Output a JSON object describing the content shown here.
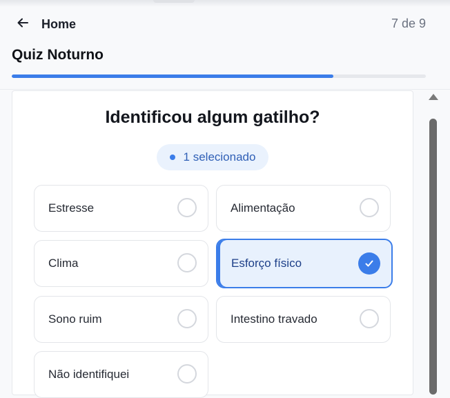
{
  "header": {
    "back_label": "Home",
    "progress_text": "7 de 9",
    "title": "Quiz Noturno",
    "progress_fraction": 0.777
  },
  "question": {
    "text": "Identificou algum gatilho?",
    "selected_badge": "1 selecionado"
  },
  "options": [
    {
      "label": "Estresse",
      "selected": false
    },
    {
      "label": "Alimentação",
      "selected": false
    },
    {
      "label": "Clima",
      "selected": false
    },
    {
      "label": "Esforço físico",
      "selected": true
    },
    {
      "label": "Sono ruim",
      "selected": false
    },
    {
      "label": "Intestino travado",
      "selected": false
    },
    {
      "label": "Não identifiquei",
      "selected": false
    }
  ],
  "colors": {
    "accent": "#3b7de9",
    "selected_bg": "#e8f1fd",
    "badge_bg": "#eaf2fd",
    "badge_text": "#2f5fb6"
  },
  "icons": {
    "back": "arrow-left-icon",
    "radio": "radio-circle-icon",
    "check": "check-icon"
  }
}
